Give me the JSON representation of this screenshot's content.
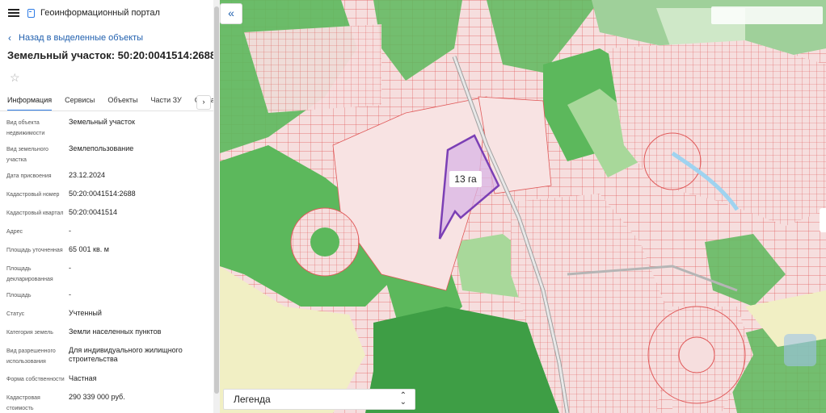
{
  "header": {
    "app_title": "Геоинформационный портал"
  },
  "icons": {
    "menu": "hamburger-icon",
    "logo": "document-icon",
    "back": "chevron-left-icon",
    "favorite": "star-icon",
    "collapse": "double-chevron-left-icon",
    "tabs_next": "chevron-right-icon",
    "legend_toggle": "sort-arrows-icon"
  },
  "nav": {
    "back_label": "Назад в выделенные объекты"
  },
  "parcel": {
    "title": "Земельный участок: 50:20:0041514:2688"
  },
  "tabs": [
    {
      "label": "Информация",
      "active": true
    },
    {
      "label": "Сервисы",
      "active": false
    },
    {
      "label": "Объекты",
      "active": false
    },
    {
      "label": "Части ЗУ",
      "active": false
    },
    {
      "label": "Состав",
      "active": false
    }
  ],
  "details": [
    {
      "label": "Вид объекта недвижимости",
      "value": "Земельный участок"
    },
    {
      "label": "Вид земельного участка",
      "value": "Землепользование"
    },
    {
      "label": "Дата присвоения",
      "value": "23.12.2024"
    },
    {
      "label": "Кадастровый номер",
      "value": "50:20:0041514:2688"
    },
    {
      "label": "Кадастровый квартал",
      "value": "50:20:0041514"
    },
    {
      "label": "Адрес",
      "value": "-"
    },
    {
      "label": "Площадь уточненная",
      "value": "65 001 кв. м"
    },
    {
      "label": "Площадь декларированная",
      "value": "-"
    },
    {
      "label": "Площадь",
      "value": "-"
    },
    {
      "label": "Статус",
      "value": "Учтенный"
    },
    {
      "label": "Категория земель",
      "value": "Земли населенных пунктов"
    },
    {
      "label": "Вид разрешенного использования",
      "value": "Для индивидуального жилищного строительства"
    },
    {
      "label": "Форма собственности",
      "value": "Частная"
    },
    {
      "label": "Кадастровая стоимость",
      "value": "290 339 000 руб."
    }
  ],
  "map": {
    "area_label": "13 га",
    "legend_label": "Легенда",
    "colors": {
      "parcel_fill": "#f6dede",
      "parcel_line": "#e05a5a",
      "green": "#5cb85c",
      "dark_green": "#3e9e45",
      "light_green": "#a8d89a",
      "sand": "#f1efc4",
      "selected_outline": "#7b3fb5",
      "selected_fill": "#d9b6e6"
    }
  }
}
